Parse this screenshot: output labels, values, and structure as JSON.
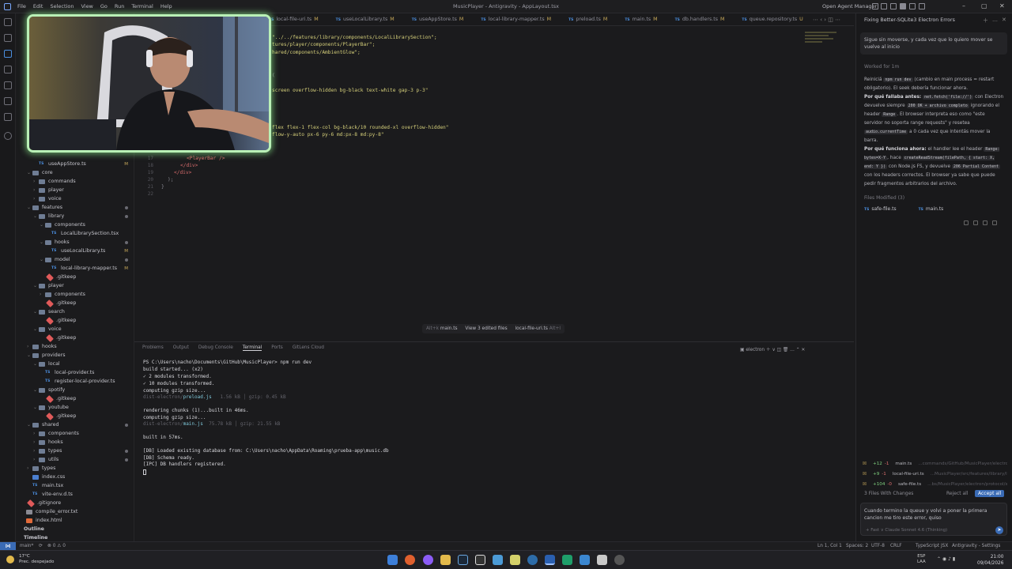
{
  "titlebar": {
    "menu": [
      "File",
      "Edit",
      "Selection",
      "View",
      "Go",
      "Run",
      "Terminal",
      "Help"
    ],
    "window_title": "MusicPlayer - Antigravity - AppLayout.tsx",
    "agent_manager": "Open Agent Manager"
  },
  "tabs": [
    {
      "label": "local-file-uri.ts",
      "modified": "M"
    },
    {
      "label": "useLocalLibrary.ts",
      "modified": "M"
    },
    {
      "label": "useAppStore.ts",
      "modified": "M"
    },
    {
      "label": "local-library-mapper.ts",
      "modified": "M"
    },
    {
      "label": "preload.ts",
      "modified": "M"
    },
    {
      "label": "main.ts",
      "modified": "M"
    },
    {
      "label": "db.handlers.ts",
      "modified": "M"
    },
    {
      "label": "queue.repository.ts",
      "modified": "U"
    }
  ],
  "code": [
    "\"../../features/library/components/LocalLibrarySection\";",
    "tures/player/components/PlayerBar\";",
    "hared/components/AmbientGlow\";",
    "(",
    "screen overflow-hidden bg-black text-white gap-3 p-3\"",
    "flex flex-1 flex-col bg-black/10 rounded-xl overflow-hidden\"",
    "flow-y-auto px-6 py-6 md:px-8 md:py-8\""
  ],
  "code_tail": {
    "lines": [
      "<PlayerBar />",
      "</div>",
      "</div>",
      ");",
      "}",
      ""
    ],
    "numbers": [
      "17",
      "18",
      "19",
      "20",
      "21",
      "22"
    ]
  },
  "explorer": {
    "rows": [
      {
        "label": "useAppStore.ts",
        "kind": "ts",
        "indent": 2,
        "badge": "M"
      },
      {
        "label": "core",
        "kind": "folder",
        "indent": 1,
        "chev": "v"
      },
      {
        "label": "commands",
        "kind": "folder",
        "indent": 2,
        "chev": ">"
      },
      {
        "label": "player",
        "kind": "folder",
        "indent": 2,
        "chev": ">"
      },
      {
        "label": "voice",
        "kind": "folder",
        "indent": 2,
        "chev": ">"
      },
      {
        "label": "features",
        "kind": "folder",
        "indent": 1,
        "chev": "v",
        "dot": true
      },
      {
        "label": "library",
        "kind": "folder",
        "indent": 2,
        "chev": "v",
        "dot": true
      },
      {
        "label": "components",
        "kind": "folder",
        "indent": 3,
        "chev": "v"
      },
      {
        "label": "LocalLibrarySection.tsx",
        "kind": "tsx",
        "indent": 4
      },
      {
        "label": "hooks",
        "kind": "folder",
        "indent": 3,
        "chev": "v",
        "dot": true
      },
      {
        "label": "useLocalLibrary.ts",
        "kind": "ts",
        "indent": 4,
        "badge": "M"
      },
      {
        "label": "model",
        "kind": "folder",
        "indent": 3,
        "chev": "v",
        "dot": true
      },
      {
        "label": "local-library-mapper.ts",
        "kind": "ts",
        "indent": 4,
        "badge": "M"
      },
      {
        "label": ".gitkeep",
        "kind": "git",
        "indent": 3
      },
      {
        "label": "player",
        "kind": "folder",
        "indent": 2,
        "chev": "v"
      },
      {
        "label": "components",
        "kind": "folder",
        "indent": 3,
        "chev": ">"
      },
      {
        "label": ".gitkeep",
        "kind": "git",
        "indent": 3
      },
      {
        "label": "search",
        "kind": "folder",
        "indent": 2,
        "chev": "v"
      },
      {
        "label": ".gitkeep",
        "kind": "git",
        "indent": 3
      },
      {
        "label": "voice",
        "kind": "folder",
        "indent": 2,
        "chev": "v"
      },
      {
        "label": ".gitkeep",
        "kind": "git",
        "indent": 3
      },
      {
        "label": "hooks",
        "kind": "folder",
        "indent": 1,
        "chev": ">"
      },
      {
        "label": "providers",
        "kind": "folder",
        "indent": 1,
        "chev": "v"
      },
      {
        "label": "local",
        "kind": "folder",
        "indent": 2,
        "chev": "v"
      },
      {
        "label": "local-provider.ts",
        "kind": "ts",
        "indent": 3
      },
      {
        "label": "register-local-provider.ts",
        "kind": "ts",
        "indent": 3
      },
      {
        "label": "spotify",
        "kind": "folder",
        "indent": 2,
        "chev": "v"
      },
      {
        "label": ".gitkeep",
        "kind": "git",
        "indent": 3
      },
      {
        "label": "youtube",
        "kind": "folder",
        "indent": 2,
        "chev": "v"
      },
      {
        "label": ".gitkeep",
        "kind": "git",
        "indent": 3
      },
      {
        "label": "shared",
        "kind": "folder",
        "indent": 1,
        "chev": "v",
        "dot": true
      },
      {
        "label": "components",
        "kind": "folder",
        "indent": 2,
        "chev": ">"
      },
      {
        "label": "hooks",
        "kind": "folder",
        "indent": 2,
        "chev": ">"
      },
      {
        "label": "types",
        "kind": "folder",
        "indent": 2,
        "chev": ">",
        "dot": true
      },
      {
        "label": "utils",
        "kind": "folder",
        "indent": 2,
        "chev": ">",
        "dot": true
      },
      {
        "label": "types",
        "kind": "folder",
        "indent": 1,
        "chev": ">"
      },
      {
        "label": "index.css",
        "kind": "css",
        "indent": 1
      },
      {
        "label": "main.tsx",
        "kind": "tsx",
        "indent": 1
      },
      {
        "label": "vite-env.d.ts",
        "kind": "ts",
        "indent": 1
      },
      {
        "label": ".gitignore",
        "kind": "git",
        "indent": 0
      },
      {
        "label": "compile_error.txt",
        "kind": "txt",
        "indent": 0
      },
      {
        "label": "index.html",
        "kind": "html",
        "indent": 0
      }
    ],
    "outline": "Outline",
    "timeline": "Timeline"
  },
  "review": {
    "prev": "Alt+k",
    "file_a": "main.ts",
    "view": "View 3 edited files",
    "file_b": "local-file-uri.ts",
    "next": "Alt+l"
  },
  "panel": {
    "tabs": [
      "Problems",
      "Output",
      "Debug Console",
      "Terminal",
      "Ports",
      "GitLens Cloud"
    ],
    "active_tab": "Terminal",
    "shell": "electron"
  },
  "terminal": {
    "prompt": "PS C:\\Users\\nacho\\Documents\\GitHub\\MusicPlayer> npm run dev",
    "l1": "build started... (x2)",
    "l2": "✓ 2 modules transformed.",
    "l3": "✓ 10 modules transformed.",
    "l4": "computing gzip size...",
    "l5_dim": "dist-electron/",
    "l5_file": "preload.js",
    "l5_size": "1.56 kB │ gzip: 0.45 kB",
    "l6": "rendering chunks (1)...built in 46ms.",
    "l7": "computing gzip size...",
    "l8_dim": "dist-electron/",
    "l8_file": "main.js",
    "l8_size": "75.78 kB │ gzip: 21.55 kB",
    "l9": "built in 57ms.",
    "l10": "[DB] Loaded existing database from: C:\\Users\\nacho\\AppData\\Roaming\\prueba-app\\music.db",
    "l11": "[DB] Schema ready.",
    "l12": "[IPC] DB handlers registered."
  },
  "statusbar": {
    "branch": "main*",
    "sync": "⟳",
    "problems": "⊗ 0 ⚠ 0",
    "position": "Ln 1, Col 1",
    "spaces": "Spaces: 2",
    "encoding": "UTF-8",
    "eol": "CRLF",
    "language": "TypeScript JSX",
    "agent": "Antigravity - Settings"
  },
  "agent": {
    "title": "Fixing Better-SQLite3 Electron Errors",
    "user_message": "Sigue sin moverse, y cada vez que lo quiero mover se vuelve al inicio",
    "worked_for": "Worked for 1m",
    "p1_pre": "Reiniciá ",
    "p1_chip": "npm run dev",
    "p1_post": " (cambio en main process = restart obligatorio). El seek debería funcionar ahora.",
    "p2_bold": "Por qué fallaba antes:",
    "p2_chip1": "net.fetch('file://')",
    "p2_mid1": " con Electron devuelve siempre ",
    "p2_chip2": "200 OK + archivo completo",
    "p2_mid2": " ignorando el header ",
    "p2_chip3": "Range",
    "p2_mid3": ". El browser interpreta eso como \"este servidor no soporta range requests\" y resetea ",
    "p2_chip4": "audio.currentTime",
    "p2_end": " a 0 cada vez que intentás mover la barra.",
    "p3_bold": "Por qué funciona ahora:",
    "p3_mid1": " el handler lee el header ",
    "p3_chip1": "Range: bytes=X-Y",
    "p3_mid2": ", hace ",
    "p3_chip2": "createReadStream(filePath, { start: X, end: Y })",
    "p3_mid3": " con Node.js FS, y devuelve ",
    "p3_chip3": "206 Partial Content",
    "p3_end": " con los headers correctos. El browser ya sabe que puede pedir fragmentos arbitrarios del archivo.",
    "files_modified": "Files Modified (3)",
    "files": [
      "safe-file.ts",
      "main.ts"
    ],
    "changes": [
      {
        "add": "+12",
        "del": "-1",
        "file": "main.ts",
        "path": "...commands/GitHub/MusicPlayer/electron/main.ts"
      },
      {
        "add": "+9",
        "del": "-1",
        "file": "local-file-uri.ts",
        "path": "...MusicPlayer/src/features/library/local-file-uri.ts"
      },
      {
        "add": "+104",
        "del": "-0",
        "file": "safe-file.ts",
        "path": "...bs/MusicPlayer/electron/protocol/safe-file.ts"
      }
    ],
    "changes_count": "3 Files With Changes",
    "reject_all": "Reject all",
    "accept_all": "Accept all",
    "input_text": "Cuando termino la queue y volvi a poner la primera cancion me tiro este error, quiso",
    "input_opts": "+   Fast   ∨   Claude Sonnet 4.6 (Thinking)"
  },
  "taskbar": {
    "temp": "17°C",
    "weather": "Prec. despejado",
    "lang1": "ESP",
    "lang2": "LAA",
    "time": "21:00",
    "date": "09/04/2026"
  },
  "colors": {
    "accent": "#3a6bb5",
    "webcam_border": "#b9f0b6",
    "code_string": "#d5cf7a",
    "modified_badge": "#c8a95a"
  }
}
